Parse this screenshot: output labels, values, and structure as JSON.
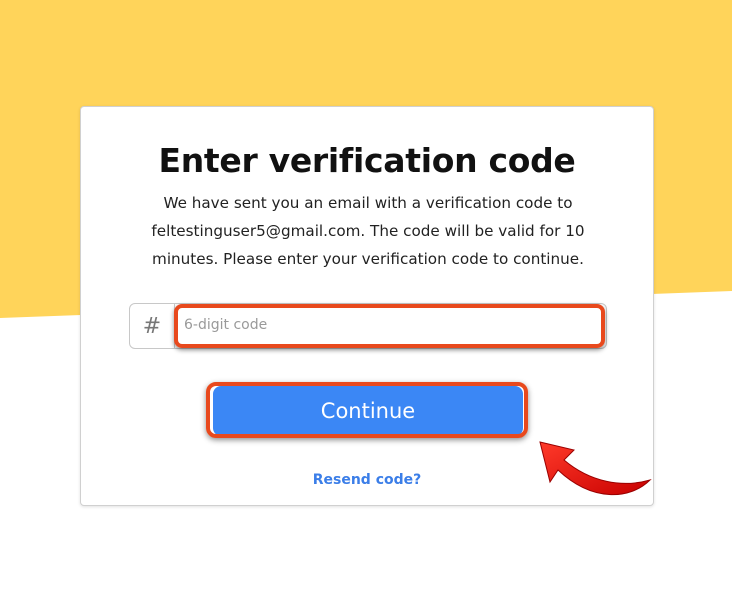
{
  "card": {
    "title": "Enter verification code",
    "description": "We have sent you an email with a verification code to feltestinguser5@gmail.com. The code will be valid for 10 minutes. Please enter your verification code to continue."
  },
  "code_field": {
    "prefix_symbol": "#",
    "placeholder": "6-digit code",
    "value": ""
  },
  "continue_button": {
    "label": "Continue"
  },
  "resend_link": {
    "label": "Resend code?"
  },
  "colors": {
    "background_yellow": "#ffd45a",
    "primary_blue": "#3b87f5",
    "link_blue": "#3b7ee8",
    "highlight_red": "#e8491d",
    "arrow_red": "#e41010"
  },
  "icons": [
    "hash-icon",
    "curved-arrow-icon"
  ]
}
